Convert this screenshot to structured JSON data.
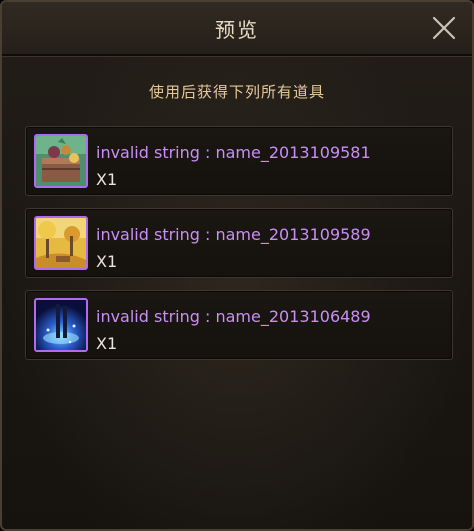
{
  "dialog": {
    "title": "预览",
    "subtitle": "使用后获得下列所有道具",
    "close_icon": "close-icon"
  },
  "items": [
    {
      "name": "invalid string : name_2013109581",
      "quantity": "X1",
      "icon": "treasure-chest-icon",
      "rarity_color": "#b06cf0"
    },
    {
      "name": "invalid string : name_2013109589",
      "quantity": "X1",
      "icon": "autumn-scene-icon",
      "rarity_color": "#b06cf0"
    },
    {
      "name": "invalid string : name_2013106489",
      "quantity": "X1",
      "icon": "blue-aura-icon",
      "rarity_color": "#b06cf0"
    }
  ]
}
